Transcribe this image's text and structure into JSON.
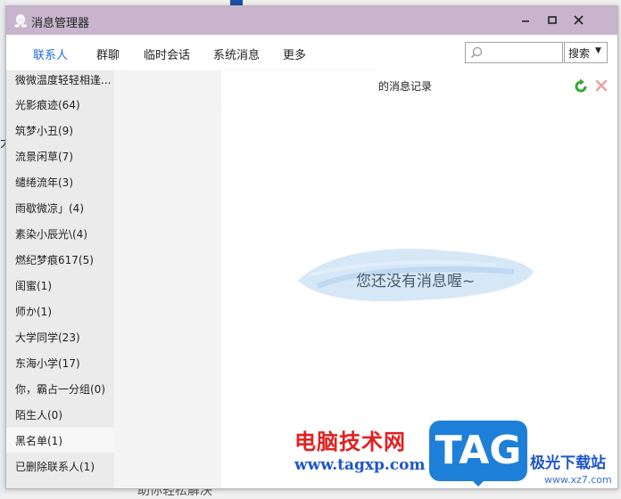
{
  "window": {
    "title": "消息管理器"
  },
  "nav": {
    "tabs": [
      "联系人",
      "群聊",
      "临时会话",
      "系统消息",
      "更多"
    ],
    "active_tab": "联系人",
    "search_placeholder": "",
    "search_button": "搜索"
  },
  "contacts": [
    {
      "label": "微微温度轻轻相逢..."
    },
    {
      "label": "光影痕迹(64)"
    },
    {
      "label": "筑梦小丑(9)"
    },
    {
      "label": "流景闲草(7)"
    },
    {
      "label": "缱绻流年(3)"
    },
    {
      "label": "雨歇微凉」(4)"
    },
    {
      "label": "素染小辰光\\(4)"
    },
    {
      "label": "燃纪梦痕617(5)"
    },
    {
      "label": "闺蜜(1)"
    },
    {
      "label": "师か(1)"
    },
    {
      "label": "大学同学(23)"
    },
    {
      "label": "东海小学(17)"
    },
    {
      "label": "你，霸占一分组(0)"
    },
    {
      "label": "陌生人(0)"
    },
    {
      "label": "黑名单(1)"
    },
    {
      "label": "已删除联系人(1)"
    }
  ],
  "selected_contact": "黑名单(1)",
  "main": {
    "record_title": "的消息记录",
    "empty_message": "您还没有消息喔~"
  },
  "background": {
    "left_char": "大",
    "bottom_text": "助你轻松解决"
  },
  "watermark": {
    "brand": "电脑技术网",
    "url": "www.tagxp.com",
    "tag": "TAG",
    "site_title": "极光下载站",
    "site_url": "www.xz7.com"
  },
  "colors": {
    "titlebar": "#c8b4cc",
    "active_tab": "#1e6fd9",
    "sidebar": "#ebebeb",
    "brand_red": "#e02020",
    "brand_blue": "#1e7fd8"
  }
}
